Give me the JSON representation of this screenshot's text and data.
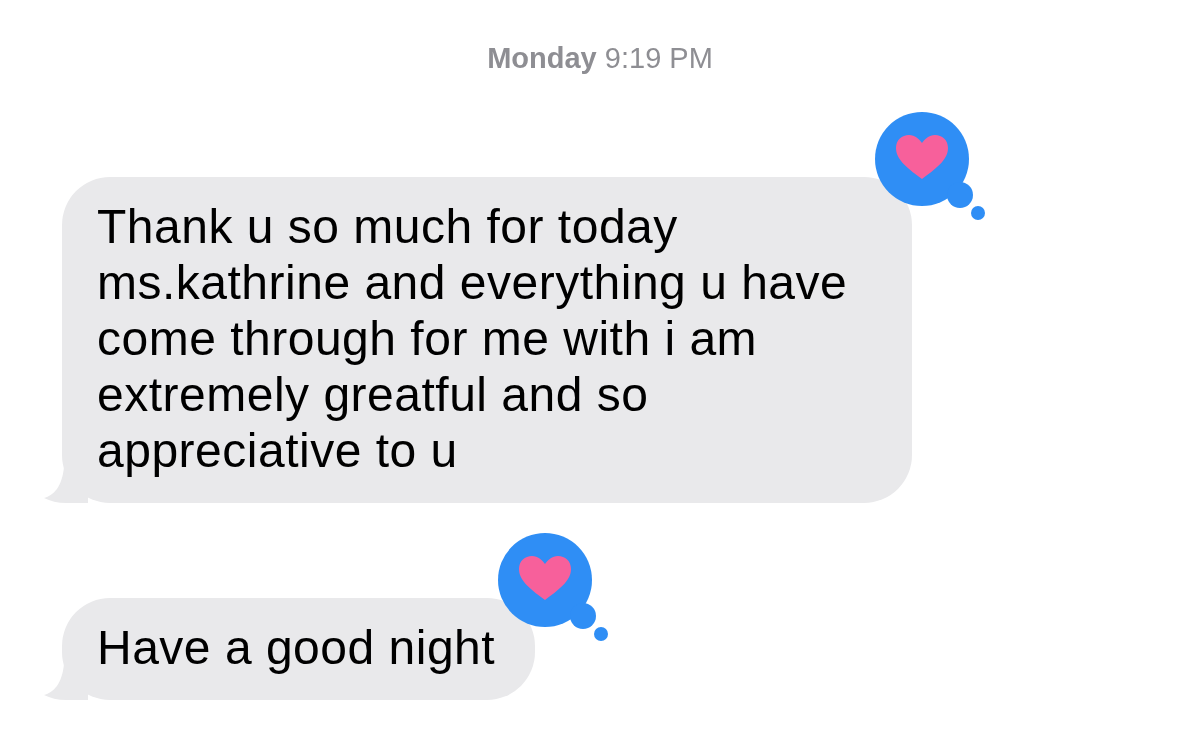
{
  "timestamp": {
    "day": "Monday",
    "time": "9:19 PM"
  },
  "messages": [
    {
      "text": "Thank u so much for today ms.kathrine and everything u have come through for me with i am extremely greatful and so appreciative to u",
      "hearted": true
    },
    {
      "text": "Have a good night",
      "hearted": true
    }
  ]
}
